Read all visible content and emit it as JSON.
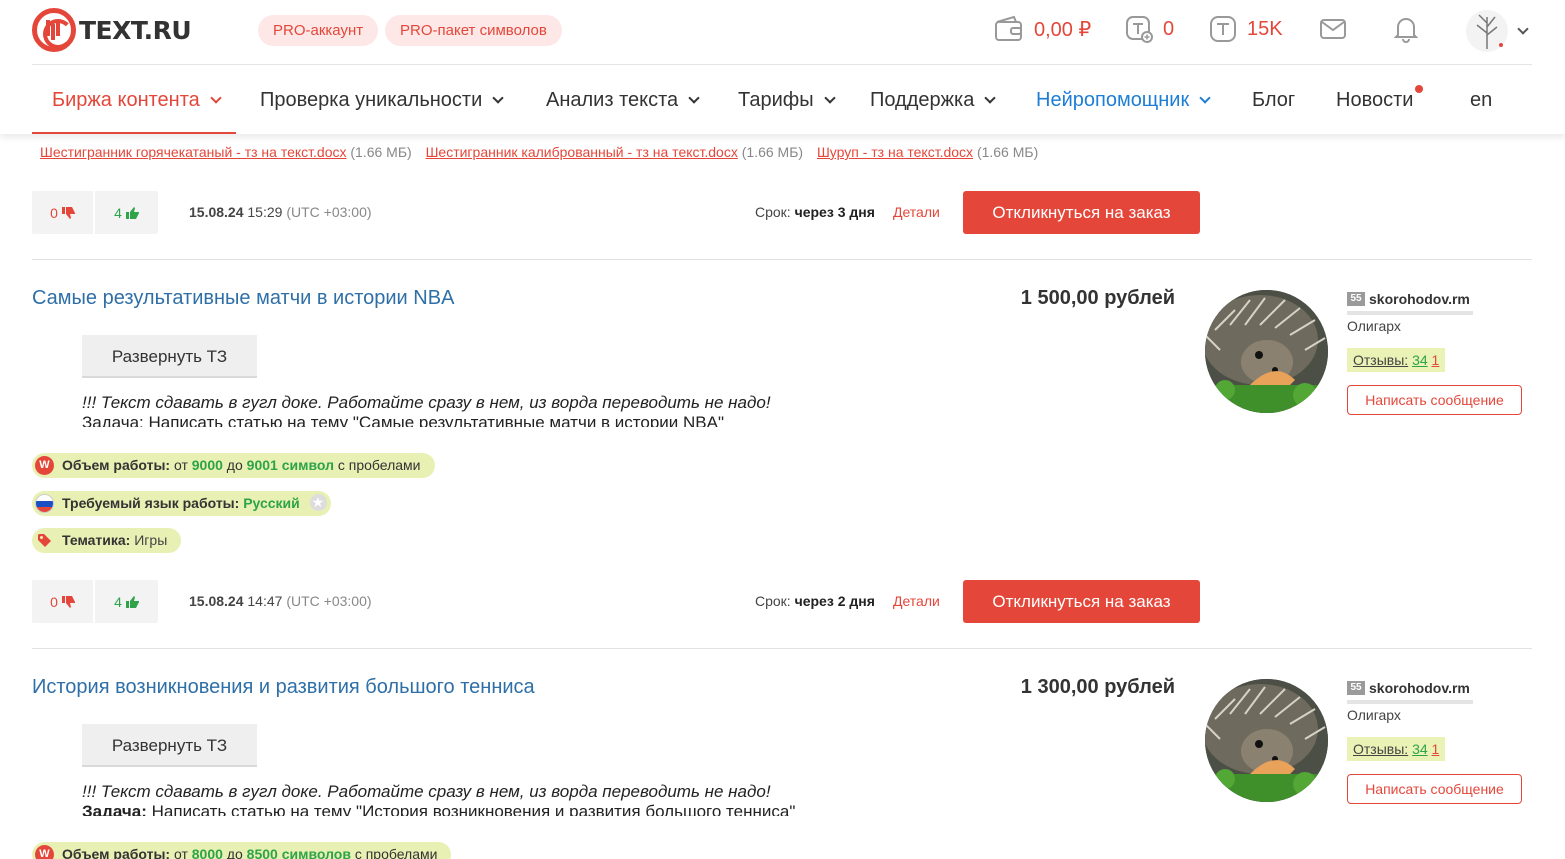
{
  "header": {
    "logo_text": "TEXT.RU",
    "pro_account": "PRO-аккаунт",
    "pro_package": "PRO-пакет символов",
    "balance": "0,00 ₽",
    "tokens": "0",
    "symbols": "15K",
    "accent_color": "#e4473a"
  },
  "nav": {
    "items": [
      {
        "label": "Биржа контента",
        "dropdown": true,
        "active": true
      },
      {
        "label": "Проверка уникальности",
        "dropdown": true
      },
      {
        "label": "Анализ текста",
        "dropdown": true
      },
      {
        "label": "Тарифы",
        "dropdown": true
      },
      {
        "label": "Поддержка",
        "dropdown": true
      },
      {
        "label": "Нейропомощник",
        "dropdown": true,
        "highlight": true
      },
      {
        "label": "Блог"
      },
      {
        "label": "Новости",
        "badge_dot": true
      },
      {
        "label": "en"
      }
    ]
  },
  "prev_order": {
    "files": [
      {
        "name": "Шестигранник горячекатаный - тз на текст.docx",
        "size": "(1.66 МБ)"
      },
      {
        "name": "Шестигранник калиброванный - тз на текст.docx",
        "size": "(1.66 МБ)"
      },
      {
        "name": "Шуруп - тз на текст.docx",
        "size": "(1.66 МБ)"
      }
    ],
    "votes_down": "0",
    "votes_up": "4",
    "date": "15.08.24",
    "time": "15:29",
    "tz": "(UTC +03:00)",
    "deadline_label": "Срок:",
    "deadline_value": "через 3 дня",
    "details": "Детали",
    "respond": "Откликнуться на заказ"
  },
  "orders": [
    {
      "title": "Самые результативные матчи в истории NBA",
      "price": "1 500,00 рублей",
      "expand": "Развернуть ТЗ",
      "desc_line1": "!!! Текст сдавать в гугл доке. Работайте сразу в нем, из ворда переводить не надо!",
      "desc_label": "Задача:",
      "desc_line2": " Написать статью на тему \"Самые результативные матчи в истории NBA\"",
      "customer": {
        "rank": "55",
        "name": "skorohodov.rm",
        "status": "Олигарх",
        "reviews_label": "Отзывы:",
        "reviews_pos": "34",
        "reviews_neg": "1",
        "message": "Написать сообщение"
      },
      "volume": {
        "label": "Объем работы:",
        "from": "от",
        "min": "9000",
        "to": "до",
        "max": "9001 символ",
        "suffix": "с пробелами"
      },
      "language": {
        "label": "Требуемый язык работы:",
        "value": "Русский"
      },
      "topic": {
        "label": "Тематика:",
        "value": "Игры"
      },
      "votes_down": "0",
      "votes_up": "4",
      "date": "15.08.24",
      "time": "14:47",
      "tz": "(UTC +03:00)",
      "deadline_label": "Срок:",
      "deadline_value": "через 2 дня",
      "details": "Детали",
      "respond": "Откликнуться на заказ"
    },
    {
      "title": "История возникновения и развития большого тенниса",
      "price": "1 300,00 рублей",
      "expand": "Развернуть ТЗ",
      "desc_line1": "!!! Текст сдавать в гугл доке. Работайте сразу в нем, из ворда переводить не надо!",
      "desc_label": "Задача:",
      "desc_line2": " Написать статью на тему \"История возникновения и развития большого тенниса\"",
      "customer": {
        "rank": "55",
        "name": "skorohodov.rm",
        "status": "Олигарх",
        "reviews_label": "Отзывы:",
        "reviews_pos": "34",
        "reviews_neg": "1",
        "message": "Написать сообщение"
      },
      "volume": {
        "label": "Объем работы:",
        "from": "от",
        "min": "8000",
        "to": "до",
        "max": "8500 символов",
        "suffix": "с пробелами"
      }
    }
  ]
}
